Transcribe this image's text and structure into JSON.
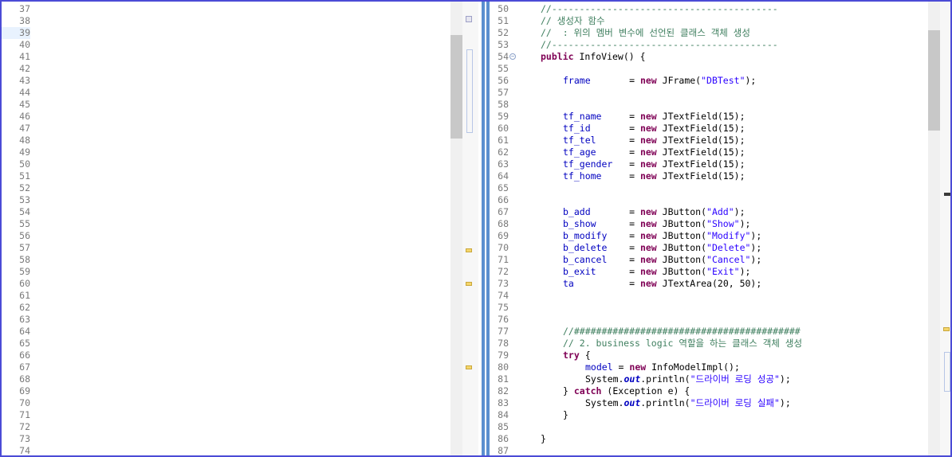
{
  "left_editor": {
    "line_numbers": [
      "37",
      "38",
      "39",
      "40",
      "41",
      "42",
      "43",
      "44",
      "45",
      "46",
      "47",
      "48",
      "49",
      "50",
      "51",
      "52",
      "53",
      "54",
      "55",
      "56",
      "57",
      "58",
      "59",
      "60",
      "61",
      "62",
      "63",
      "64",
      "65",
      "66",
      "67",
      "68",
      "69",
      "70",
      "71",
      "72",
      "73",
      "74"
    ],
    "current_line": "39"
  },
  "right_editor": {
    "line_numbers": [
      "50",
      "51",
      "52",
      "53",
      "54",
      "55",
      "56",
      "57",
      "58",
      "59",
      "60",
      "61",
      "62",
      "63",
      "64",
      "65",
      "66",
      "67",
      "68",
      "69",
      "70",
      "71",
      "72",
      "73",
      "74",
      "75",
      "76",
      "77",
      "78",
      "79",
      "80",
      "81",
      "82",
      "83",
      "84",
      "85",
      "86",
      "87"
    ],
    "fold_icon_line": "54",
    "code_lines": [
      {
        "indent": 0,
        "tokens": [
          {
            "c": "cm",
            "t": "//-----------------------------------------"
          }
        ]
      },
      {
        "indent": 0,
        "tokens": [
          {
            "c": "cm",
            "t": "// 생성자 함수"
          }
        ]
      },
      {
        "indent": 0,
        "tokens": [
          {
            "c": "cm",
            "t": "//  : 위의 멤버 변수에 선언된 클래스 객체 생성"
          }
        ]
      },
      {
        "indent": 0,
        "tokens": [
          {
            "c": "cm",
            "t": "//-----------------------------------------"
          }
        ]
      },
      {
        "indent": 0,
        "tokens": [
          {
            "c": "kw",
            "t": "public"
          },
          {
            "c": "",
            "t": " InfoView() {"
          }
        ]
      },
      {
        "indent": 0,
        "tokens": []
      },
      {
        "indent": 1,
        "tokens": [
          {
            "c": "fd",
            "t": "frame"
          },
          {
            "c": "",
            "t": "       = "
          },
          {
            "c": "kw",
            "t": "new"
          },
          {
            "c": "",
            "t": " JFrame("
          },
          {
            "c": "st",
            "t": "\"DBTest\""
          },
          {
            "c": "",
            "t": ");"
          }
        ]
      },
      {
        "indent": 0,
        "tokens": []
      },
      {
        "indent": 0,
        "tokens": []
      },
      {
        "indent": 1,
        "tokens": [
          {
            "c": "fd",
            "t": "tf_name"
          },
          {
            "c": "",
            "t": "     = "
          },
          {
            "c": "kw",
            "t": "new"
          },
          {
            "c": "",
            "t": " JTextField(15);"
          }
        ]
      },
      {
        "indent": 1,
        "tokens": [
          {
            "c": "fd",
            "t": "tf_id"
          },
          {
            "c": "",
            "t": "       = "
          },
          {
            "c": "kw",
            "t": "new"
          },
          {
            "c": "",
            "t": " JTextField(15);"
          }
        ]
      },
      {
        "indent": 1,
        "tokens": [
          {
            "c": "fd",
            "t": "tf_tel"
          },
          {
            "c": "",
            "t": "      = "
          },
          {
            "c": "kw",
            "t": "new"
          },
          {
            "c": "",
            "t": " JTextField(15);"
          }
        ]
      },
      {
        "indent": 1,
        "tokens": [
          {
            "c": "fd",
            "t": "tf_age"
          },
          {
            "c": "",
            "t": "      = "
          },
          {
            "c": "kw",
            "t": "new"
          },
          {
            "c": "",
            "t": " JTextField(15);"
          }
        ]
      },
      {
        "indent": 1,
        "tokens": [
          {
            "c": "fd",
            "t": "tf_gender"
          },
          {
            "c": "",
            "t": "   = "
          },
          {
            "c": "kw",
            "t": "new"
          },
          {
            "c": "",
            "t": " JTextField(15);"
          }
        ]
      },
      {
        "indent": 1,
        "tokens": [
          {
            "c": "fd",
            "t": "tf_home"
          },
          {
            "c": "",
            "t": "     = "
          },
          {
            "c": "kw",
            "t": "new"
          },
          {
            "c": "",
            "t": " JTextField(15);"
          }
        ]
      },
      {
        "indent": 0,
        "tokens": []
      },
      {
        "indent": 0,
        "tokens": []
      },
      {
        "indent": 1,
        "tokens": [
          {
            "c": "fd",
            "t": "b_add"
          },
          {
            "c": "",
            "t": "       = "
          },
          {
            "c": "kw",
            "t": "new"
          },
          {
            "c": "",
            "t": " JButton("
          },
          {
            "c": "st",
            "t": "\"Add\""
          },
          {
            "c": "",
            "t": ");"
          }
        ]
      },
      {
        "indent": 1,
        "tokens": [
          {
            "c": "fd",
            "t": "b_show"
          },
          {
            "c": "",
            "t": "      = "
          },
          {
            "c": "kw",
            "t": "new"
          },
          {
            "c": "",
            "t": " JButton("
          },
          {
            "c": "st",
            "t": "\"Show\""
          },
          {
            "c": "",
            "t": ");"
          }
        ]
      },
      {
        "indent": 1,
        "tokens": [
          {
            "c": "fd",
            "t": "b_modify"
          },
          {
            "c": "",
            "t": "    = "
          },
          {
            "c": "kw",
            "t": "new"
          },
          {
            "c": "",
            "t": " JButton("
          },
          {
            "c": "st",
            "t": "\"Modify\""
          },
          {
            "c": "",
            "t": ");"
          }
        ]
      },
      {
        "indent": 1,
        "tokens": [
          {
            "c": "fd",
            "t": "b_delete"
          },
          {
            "c": "",
            "t": "    = "
          },
          {
            "c": "kw",
            "t": "new"
          },
          {
            "c": "",
            "t": " JButton("
          },
          {
            "c": "st",
            "t": "\"Delete\""
          },
          {
            "c": "",
            "t": ");"
          }
        ]
      },
      {
        "indent": 1,
        "tokens": [
          {
            "c": "fd",
            "t": "b_cancel"
          },
          {
            "c": "",
            "t": "    = "
          },
          {
            "c": "kw",
            "t": "new"
          },
          {
            "c": "",
            "t": " JButton("
          },
          {
            "c": "st",
            "t": "\"Cancel\""
          },
          {
            "c": "",
            "t": ");"
          }
        ]
      },
      {
        "indent": 1,
        "tokens": [
          {
            "c": "fd",
            "t": "b_exit"
          },
          {
            "c": "",
            "t": "      = "
          },
          {
            "c": "kw",
            "t": "new"
          },
          {
            "c": "",
            "t": " JButton("
          },
          {
            "c": "st",
            "t": "\"Exit\""
          },
          {
            "c": "",
            "t": ");"
          }
        ]
      },
      {
        "indent": 1,
        "tokens": [
          {
            "c": "fd",
            "t": "ta"
          },
          {
            "c": "",
            "t": "          = "
          },
          {
            "c": "kw",
            "t": "new"
          },
          {
            "c": "",
            "t": " JTextArea(20, 50);"
          }
        ]
      },
      {
        "indent": 0,
        "tokens": []
      },
      {
        "indent": 0,
        "tokens": []
      },
      {
        "indent": 0,
        "tokens": []
      },
      {
        "indent": 1,
        "tokens": [
          {
            "c": "cm",
            "t": "//#########################################"
          }
        ]
      },
      {
        "indent": 1,
        "tokens": [
          {
            "c": "cm",
            "t": "// 2. business logic 역할을 하는 클래스 객체 생성"
          }
        ]
      },
      {
        "indent": 1,
        "tokens": [
          {
            "c": "kw",
            "t": "try"
          },
          {
            "c": "",
            "t": " {"
          }
        ]
      },
      {
        "indent": 2,
        "tokens": [
          {
            "c": "fd",
            "t": "model"
          },
          {
            "c": "",
            "t": " = "
          },
          {
            "c": "kw",
            "t": "new"
          },
          {
            "c": "",
            "t": " InfoModelImpl();"
          }
        ]
      },
      {
        "indent": 2,
        "tokens": [
          {
            "c": "",
            "t": "System."
          },
          {
            "c": "it",
            "t": "out"
          },
          {
            "c": "",
            "t": ".println("
          },
          {
            "c": "st",
            "t": "\"드라이버 로딩 성공\""
          },
          {
            "c": "",
            "t": ");"
          }
        ]
      },
      {
        "indent": 1,
        "tokens": [
          {
            "c": "",
            "t": "} "
          },
          {
            "c": "kw",
            "t": "catch"
          },
          {
            "c": "",
            "t": " (Exception e) {"
          }
        ]
      },
      {
        "indent": 2,
        "tokens": [
          {
            "c": "",
            "t": "System."
          },
          {
            "c": "it",
            "t": "out"
          },
          {
            "c": "",
            "t": ".println("
          },
          {
            "c": "st",
            "t": "\"드라이버 로딩 실패\""
          },
          {
            "c": "",
            "t": ");"
          }
        ]
      },
      {
        "indent": 1,
        "tokens": [
          {
            "c": "",
            "t": "}"
          }
        ]
      },
      {
        "indent": 0,
        "tokens": []
      },
      {
        "indent": 0,
        "tokens": [
          {
            "c": "",
            "t": "}"
          }
        ]
      },
      {
        "indent": 0,
        "tokens": []
      }
    ]
  },
  "colors": {
    "frame_border": "#4b4bd6",
    "comment": "#3f7f5f",
    "keyword": "#7f0055",
    "field": "#0000c0",
    "string": "#2a00ff",
    "line_number": "#7a7a7a",
    "split_stripe": "#5b8fcf"
  },
  "icons": {
    "fold": "fold-collapse-icon",
    "marker": "overview-warning-marker"
  }
}
